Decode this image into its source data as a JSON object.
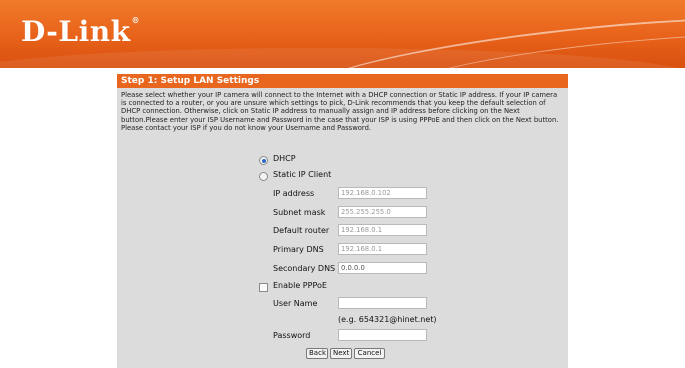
{
  "brand": {
    "name": "D-Link",
    "tm": "®"
  },
  "panel": {
    "title": "Step 1: Setup LAN Settings",
    "intro": "Please select whether your IP camera will connect to the Internet with a DHCP connection or Static IP address. If your IP camera is connected to a router, or you are unsure which settings to pick, D-Link recommends that you keep the default selection of DHCP connection. Otherwise, click on Static IP address to manually assign and IP address before clicking on the Next button.Please enter your ISP Username and Password in the case that your ISP is using PPPoE and then click on the Next button. Please contact your ISP if you do not know your Username and Password."
  },
  "form": {
    "dhcp": {
      "label": "DHCP",
      "selected": true
    },
    "static": {
      "label": "Static IP Client",
      "selected": false
    },
    "ip_address": {
      "label": "IP address",
      "value": "192.168.0.102"
    },
    "subnet_mask": {
      "label": "Subnet mask",
      "value": "255.255.255.0"
    },
    "default_router": {
      "label": "Default router",
      "value": "192.168.0.1"
    },
    "primary_dns": {
      "label": "Primary DNS",
      "value": "192.168.0.1"
    },
    "secondary_dns": {
      "label": "Secondary DNS",
      "value": "0.0.0.0"
    },
    "pppoe": {
      "label": "Enable PPPoE",
      "checked": false
    },
    "user_name": {
      "label": "User Name",
      "value": "",
      "hint": "(e.g. 654321@hinet.net)"
    },
    "password": {
      "label": "Password",
      "value": ""
    }
  },
  "buttons": {
    "back": "Back",
    "next": "Next",
    "cancel": "Cancel"
  },
  "colors": {
    "accent": "#e8661e",
    "panel_bg": "#dcdcdc",
    "radio_dot": "#2f66c9"
  }
}
